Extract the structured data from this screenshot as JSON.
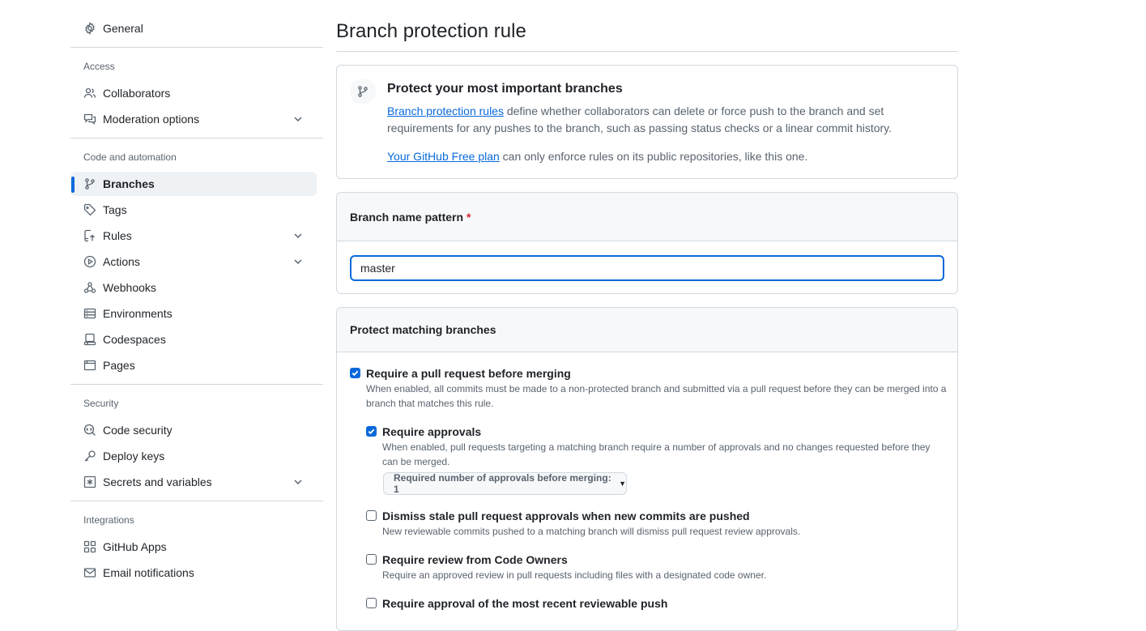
{
  "sidebar": {
    "general": "General",
    "sections": {
      "access": "Access",
      "code_automation": "Code and automation",
      "security": "Security",
      "integrations": "Integrations"
    },
    "access_items": [
      "Collaborators",
      "Moderation options"
    ],
    "code_items": [
      "Branches",
      "Tags",
      "Rules",
      "Actions",
      "Webhooks",
      "Environments",
      "Codespaces",
      "Pages"
    ],
    "security_items": [
      "Code security",
      "Deploy keys",
      "Secrets and variables"
    ],
    "integration_items": [
      "GitHub Apps",
      "Email notifications"
    ],
    "active_item": "Branches",
    "accent_color": "#0969da"
  },
  "main": {
    "title": "Branch protection rule",
    "info": {
      "title": "Protect your most important branches",
      "link1": "Branch protection rules",
      "text1": " define whether collaborators can delete or force push to the branch and set requirements for any pushes to the branch, such as passing status checks or a linear commit history.",
      "link2": "Your GitHub Free plan",
      "text2": " can only enforce rules on its public repositories, like this one."
    },
    "pattern": {
      "label": "Branch name pattern",
      "required_mark": "*",
      "value": "master"
    },
    "matching": {
      "header": "Protect matching branches",
      "options": [
        {
          "label": "Require a pull request before merging",
          "checked": true,
          "desc": "When enabled, all commits must be made to a non-protected branch and submitted via a pull request before they can be merged into a branch that matches this rule."
        },
        {
          "label": "Require approvals",
          "checked": true,
          "desc": "When enabled, pull requests targeting a matching branch require a number of approvals and no changes requested before they can be merged."
        },
        {
          "label": "Dismiss stale pull request approvals when new commits are pushed",
          "checked": false,
          "desc": "New reviewable commits pushed to a matching branch will dismiss pull request review approvals."
        },
        {
          "label": "Require review from Code Owners",
          "checked": false,
          "desc": "Require an approved review in pull requests including files with a designated code owner."
        },
        {
          "label": "Require approval of the most recent reviewable push",
          "checked": false,
          "desc": ""
        }
      ],
      "approvals_select": "Required number of approvals before merging: 1"
    }
  }
}
